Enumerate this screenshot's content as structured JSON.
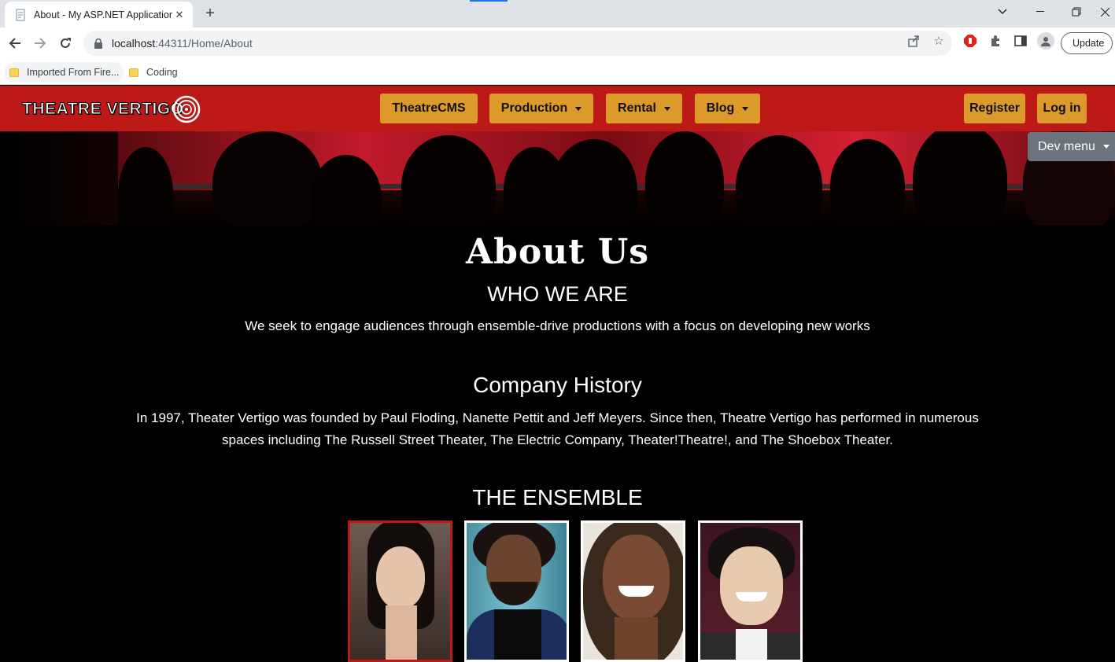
{
  "browser": {
    "tab_title": "About - My ASP.NET Application",
    "url_host": "localhost",
    "url_path": ":44311/Home/About",
    "update_label": "Update",
    "bookmarks": [
      "Imported From Fire...",
      "Coding"
    ]
  },
  "site": {
    "logo_text": "THEATRE VERTIGO",
    "nav": {
      "home": "TheatreCMS",
      "production": "Production",
      "rental": "Rental",
      "blog": "Blog",
      "register": "Register",
      "login": "Log in"
    },
    "dev_menu": "Dev menu"
  },
  "about": {
    "title": "About Us",
    "who_heading": "WHO WE ARE",
    "mission": "We seek to engage audiences through ensemble-drive productions with a focus on developing new works",
    "history_heading": "Company History",
    "history_text": "In 1997, Theater Vertigo was founded by Paul Floding, Nanette Pettit and Jeff Meyers. Since then, Theatre Vertigo has performed in numerous spaces including The Russell Street Theater, The Electric Company, Theater!Theatre!, and The Shoebox Theater.",
    "ensemble_heading": "THE ENSEMBLE"
  },
  "colors": {
    "brand_red": "#bd1a17",
    "nav_gold": "#dc9a2b",
    "dev_gray": "#6c757d"
  }
}
